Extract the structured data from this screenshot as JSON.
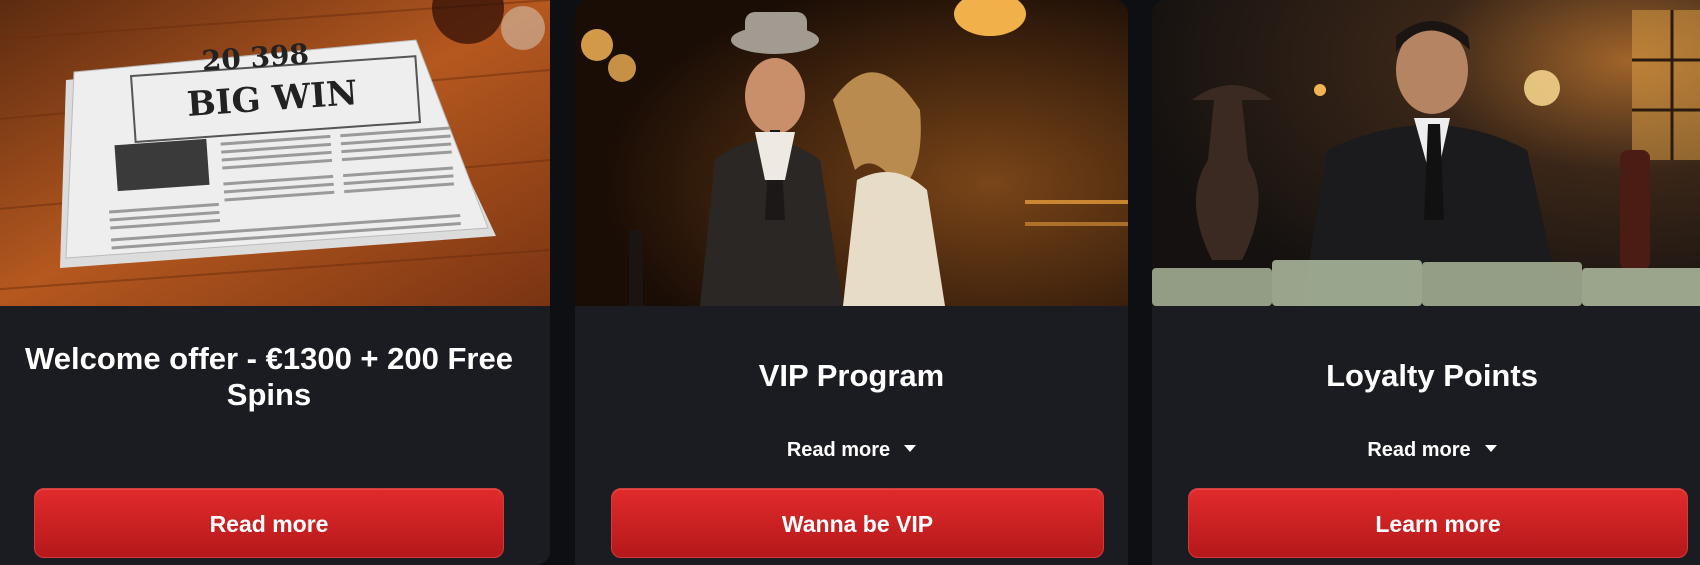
{
  "cards": [
    {
      "image": {
        "alt_icon": "newspaper-illustration",
        "headline_number": "20 398",
        "headline_text": "BIG WIN"
      },
      "title": "Welcome offer - €1300 + 200 Free Spins",
      "button_label": "Read more"
    },
    {
      "image": {
        "alt_icon": "vip-couple-illustration"
      },
      "title": "VIP Program",
      "toggle_label": "Read more",
      "button_label": "Wanna be VIP"
    },
    {
      "image": {
        "alt_icon": "gangster-money-illustration"
      },
      "title": "Loyalty Points",
      "toggle_label": "Read more",
      "button_label": "Learn more"
    }
  ],
  "colors": {
    "page_bg": "#0e0f12",
    "card_bg": "#1b1c21",
    "button_top": "#e12b2b",
    "button_bottom": "#b5181b",
    "text": "#ffffff"
  }
}
